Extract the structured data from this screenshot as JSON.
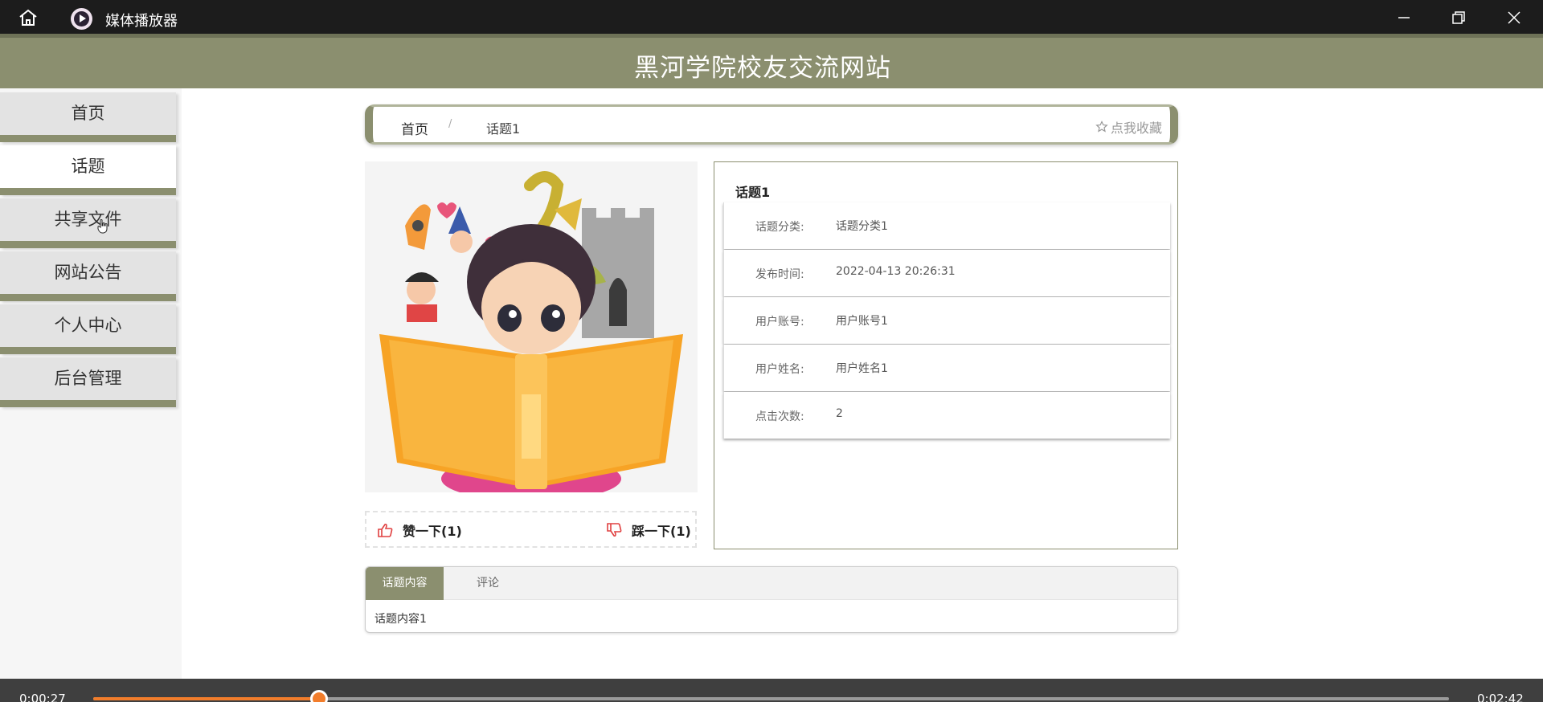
{
  "window": {
    "title": "媒体播放器",
    "icons": {
      "home": "home-icon",
      "app": "play-icon",
      "minimize": "minimize-icon",
      "maximize": "restore-icon",
      "close": "close-icon"
    }
  },
  "site": {
    "title": "黑河学院校友交流网站",
    "accent_color": "#8b8f6f"
  },
  "sidebar": {
    "items": [
      {
        "label": "首页",
        "active": false
      },
      {
        "label": "话题",
        "active": true
      },
      {
        "label": "共享文件",
        "active": false
      },
      {
        "label": "网站公告",
        "active": false
      },
      {
        "label": "个人中心",
        "active": false
      },
      {
        "label": "后台管理",
        "active": false
      }
    ]
  },
  "breadcrumb": {
    "home": "首页",
    "separator": "/",
    "current": "话题1",
    "favorite": "点我收藏"
  },
  "vote": {
    "like_label": "赞一下(1)",
    "dislike_label": "踩一下(1)"
  },
  "detail": {
    "title": "话题1",
    "rows": [
      {
        "label": "话题分类:",
        "value": "话题分类1"
      },
      {
        "label": "发布时间:",
        "value": "2022-04-13 20:26:31"
      },
      {
        "label": "用户账号:",
        "value": "用户账号1"
      },
      {
        "label": "用户姓名:",
        "value": "用户姓名1"
      },
      {
        "label": "点击次数:",
        "value": "2"
      }
    ]
  },
  "tabs": {
    "items": [
      "话题内容",
      "评论"
    ],
    "active": 0,
    "content": "话题内容1"
  },
  "media": {
    "current_time": "0:00:27",
    "total_time": "0:02:42",
    "progress": 0.1667,
    "progress_color": "#f27d2b"
  }
}
